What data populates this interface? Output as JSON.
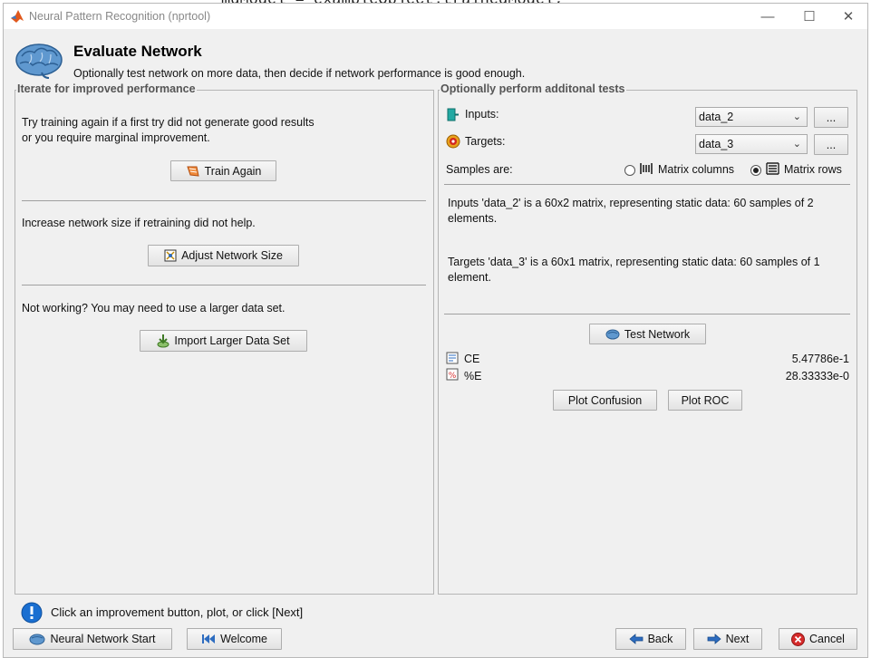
{
  "background_code": "mdModel = exampleObject.trainedModel;",
  "window": {
    "title": "Neural Pattern Recognition (nprtool)",
    "minimize_glyph": "—",
    "maximize_glyph": "☐",
    "close_glyph": "✕"
  },
  "header": {
    "title": "Evaluate Network",
    "subtitle": "Optionally test network on more data, then decide if network performance is good enough."
  },
  "left_panel": {
    "title": "Iterate for improved performance",
    "retrain_text_1": "Try training again if a first try did not generate good results",
    "retrain_text_2": "or you require marginal improvement.",
    "train_again_label": "Train Again",
    "size_text": "Increase network size if retraining did not help.",
    "adjust_size_label": "Adjust Network Size",
    "data_text": "Not working? You may need to use a larger data set.",
    "import_label": "Import Larger Data Set"
  },
  "right_panel": {
    "title": "Optionally perform additonal tests",
    "inputs_label": "Inputs:",
    "inputs_value": "data_2",
    "targets_label": "Targets:",
    "targets_value": "data_3",
    "browse_label": "...",
    "samples_label": "Samples are:",
    "matrix_columns_label": "Matrix columns",
    "matrix_rows_label": "Matrix rows",
    "samples_selected": "Matrix rows",
    "inputs_info": "Inputs 'data_2' is a 60x2 matrix, representing static data: 60 samples of 2 elements.",
    "targets_info": "Targets 'data_3' is a 60x1 matrix, representing static data: 60 samples of 1 element.",
    "test_network_label": "Test Network",
    "results": [
      {
        "label": "CE",
        "value": "5.47786e-1"
      },
      {
        "label": "%E",
        "value": "28.33333e-0"
      }
    ],
    "plot_confusion_label": "Plot Confusion",
    "plot_roc_label": "Plot ROC"
  },
  "status": {
    "message": "Click an improvement button, plot, or click [Next]"
  },
  "footer": {
    "nn_start_label": "Neural Network Start",
    "welcome_label": "Welcome",
    "back_label": "Back",
    "next_label": "Next",
    "cancel_label": "Cancel"
  },
  "colors": {
    "window_bg": "#f0f0f0",
    "info_icon": "#1a6fd1",
    "cancel_icon": "#d62b2b",
    "matlab_logo": "#e0581c"
  }
}
